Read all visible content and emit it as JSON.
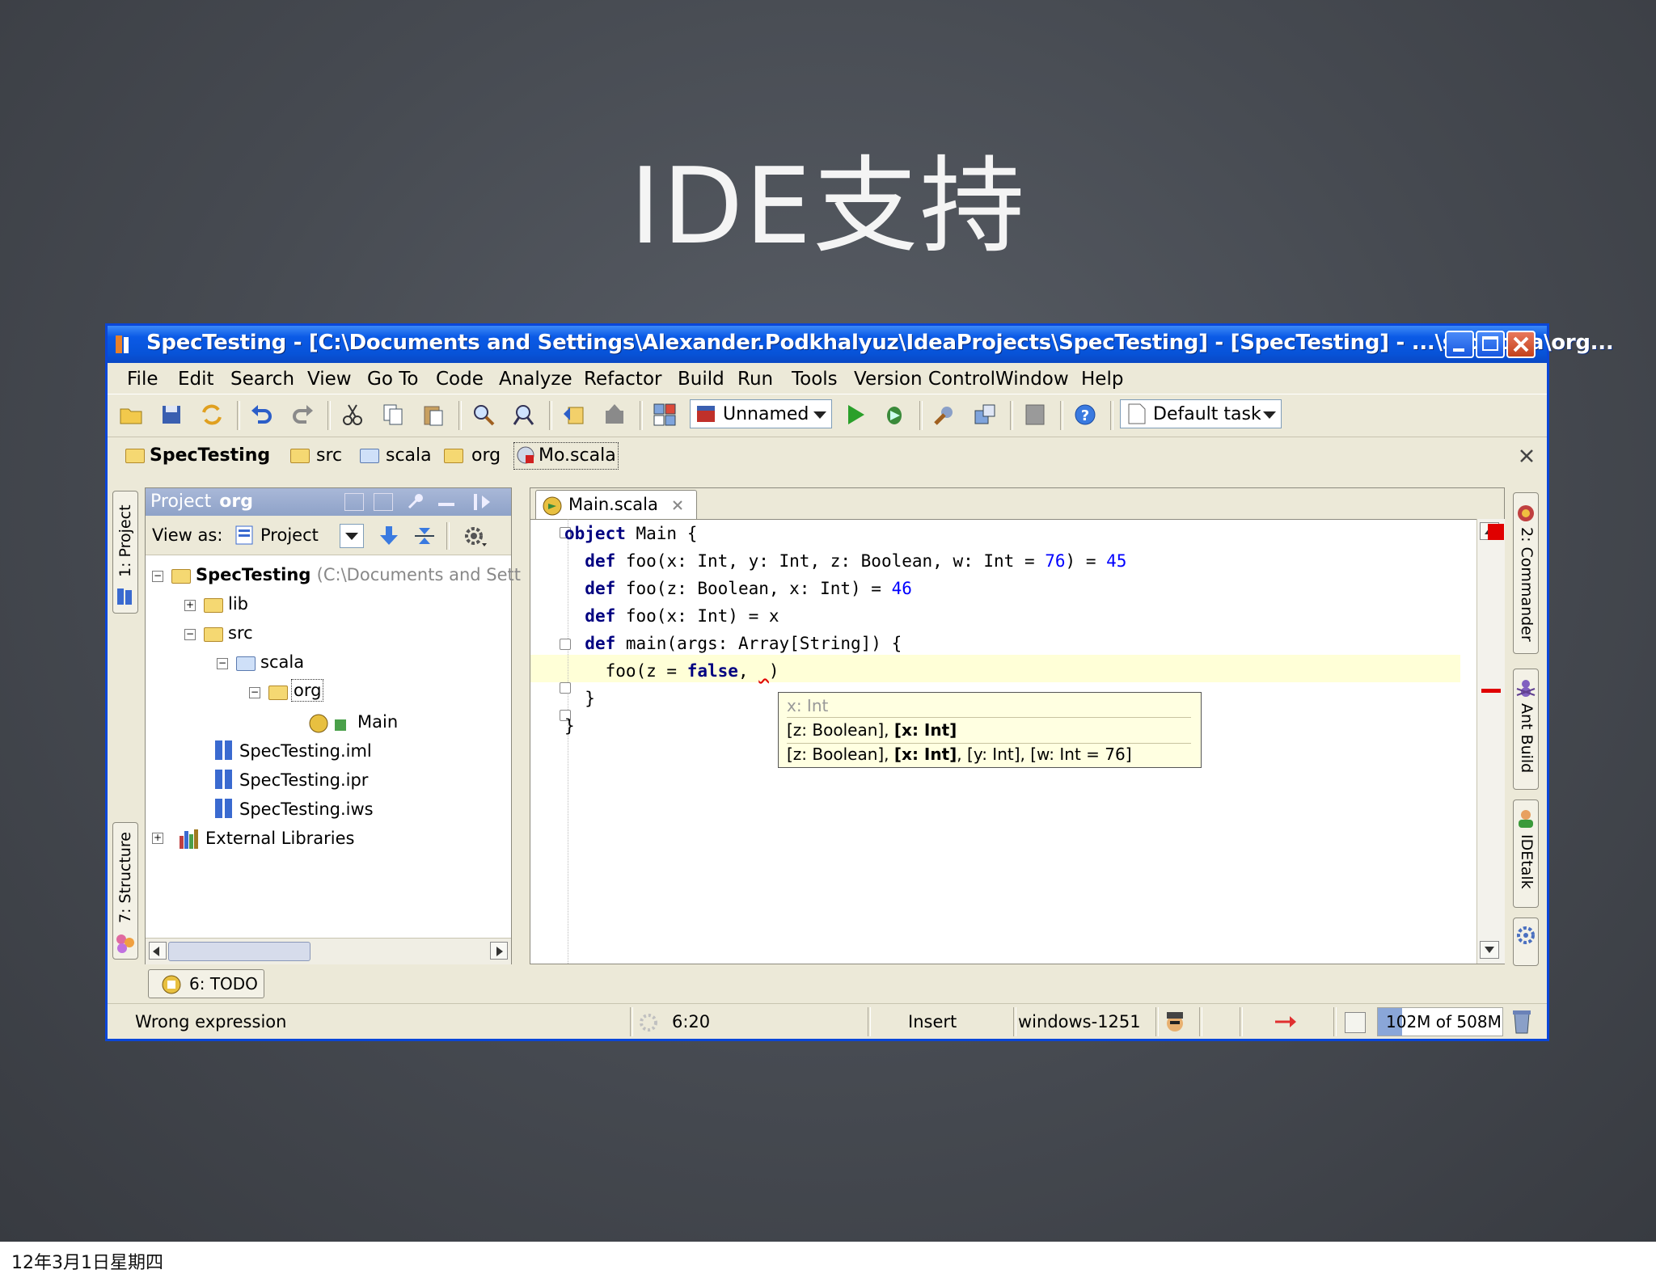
{
  "slide": {
    "title": "IDE支持",
    "footer_date": "12年3月1日星期四"
  },
  "window": {
    "title": "SpecTesting - [C:\\Documents and Settings\\Alexander.Podkhalyuz\\IdeaProjects\\SpecTesting] - [SpecTesting] - ...\\src\\scala\\org..."
  },
  "menu": [
    "File",
    "Edit",
    "Search",
    "View",
    "Go To",
    "Code",
    "Analyze",
    "Refactor",
    "Build",
    "Run",
    "Tools",
    "Version Control",
    "Window",
    "Help"
  ],
  "toolbar": {
    "run_config": "Unnamed",
    "task": "Default task"
  },
  "navbar": {
    "crumbs": [
      "SpecTesting",
      "src",
      "scala",
      "org",
      "Mo.scala"
    ]
  },
  "left_tabs": {
    "project": "1: Project",
    "structure": "7: Structure"
  },
  "project_panel": {
    "header_label": "Project",
    "header_path": "org",
    "view_as_label": "View as:",
    "view_as_value": "Project",
    "tree": {
      "root": "SpecTesting",
      "root_path": "(C:\\Documents and Sett",
      "lib": "lib",
      "src": "src",
      "scala": "scala",
      "org": "org",
      "main": "Main",
      "iml": "SpecTesting.iml",
      "ipr": "SpecTesting.ipr",
      "iws": "SpecTesting.iws",
      "ext": "External Libraries"
    }
  },
  "editor": {
    "tab": "Main.scala"
  },
  "popup": {
    "hint": "x: Int",
    "row1_pre": "[z: Boolean],",
    "row1_bold": "[x: Int]",
    "row2_pre": "[z: Boolean],",
    "row2_bold": "[x: Int]",
    "row2_post": ", [y: Int], [w: Int = 76]"
  },
  "right_tabs": {
    "commander": "2: Commander",
    "ant": "Ant Build",
    "idetalk": "IDEtalk"
  },
  "bottom": {
    "todo": "6: TODO"
  },
  "status": {
    "message": "Wrong expression",
    "position": "6:20",
    "mode": "Insert",
    "encoding": "windows-1251",
    "memory": "102M of 508M"
  },
  "colors": {
    "slide_bg": "#464a51",
    "title_bar": "#0753d8",
    "keyword": "#000080",
    "number": "#0000ff",
    "error": "#e00000"
  }
}
